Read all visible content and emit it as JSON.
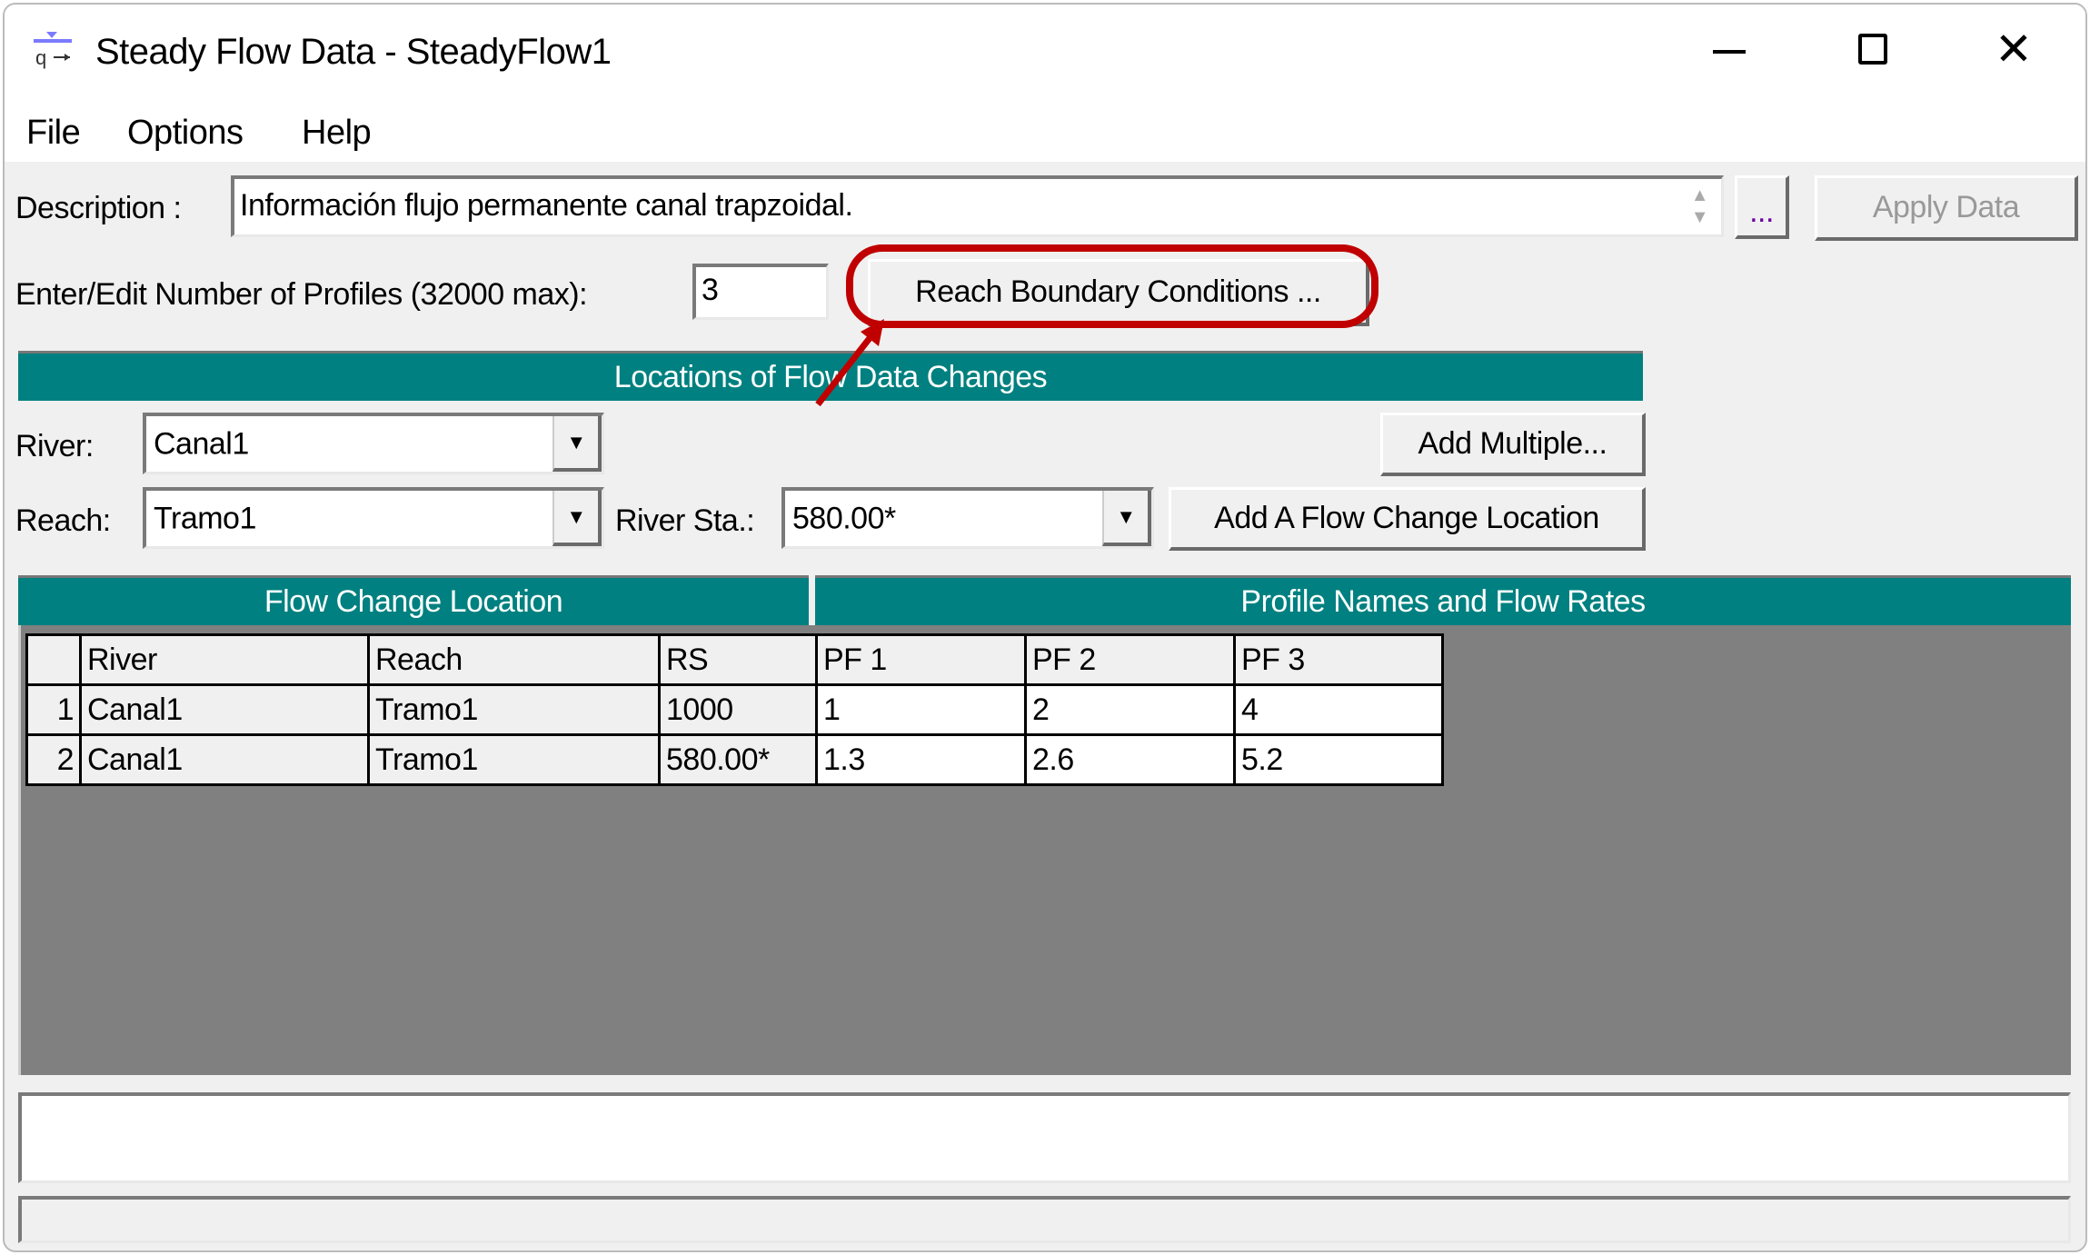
{
  "window": {
    "title": "Steady Flow Data - SteadyFlow1",
    "icon": "steady-flow-icon",
    "controls": [
      "minimize",
      "maximize",
      "close"
    ]
  },
  "menu": [
    "File",
    "Options",
    "Help"
  ],
  "description": {
    "label": "Description :",
    "value": "Información flujo permanente canal trapzoidal.",
    "ellipsis": "...",
    "apply": "Apply Data"
  },
  "profiles": {
    "label": "Enter/Edit Number of Profiles (32000 max):",
    "value": "3",
    "reach_bc": "Reach Boundary Conditions ..."
  },
  "locations": {
    "header": "Locations of Flow Data Changes",
    "river_label": "River:",
    "river_value": "Canal1",
    "reach_label": "Reach:",
    "reach_value": "Tramo1",
    "sta_label": "River Sta.:",
    "sta_value": "580.00*",
    "add_multiple": "Add Multiple...",
    "add_location": "Add A Flow Change Location"
  },
  "table": {
    "group_left": "Flow Change Location",
    "group_right": "Profile Names and Flow Rates",
    "columns": [
      "River",
      "Reach",
      "RS",
      "PF 1",
      "PF 2",
      "PF 3"
    ],
    "rows": [
      {
        "n": "1",
        "river": "Canal1",
        "reach": "Tramo1",
        "rs": "1000",
        "pf": [
          "1",
          "2",
          "4"
        ]
      },
      {
        "n": "2",
        "river": "Canal1",
        "reach": "Tramo1",
        "rs": "580.00*",
        "pf": [
          "1.3",
          "2.6",
          "5.2"
        ]
      }
    ]
  },
  "annotation_color": "#c00000",
  "colors": {
    "header": "#008080",
    "grid_bg": "#808080"
  }
}
